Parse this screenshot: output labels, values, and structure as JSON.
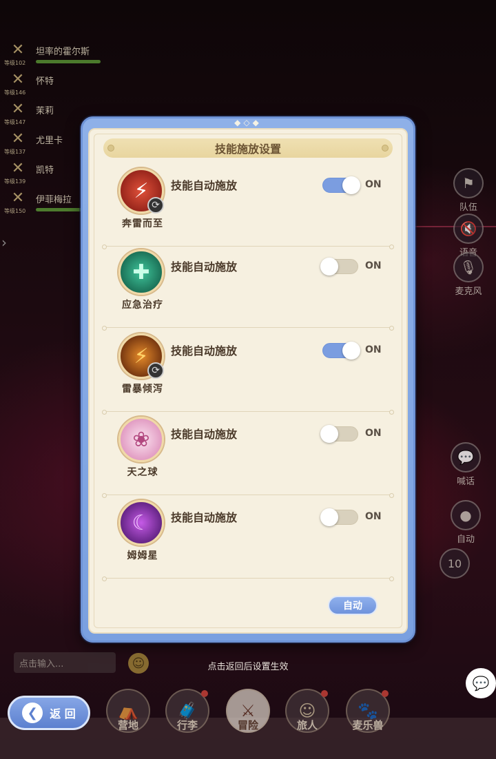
{
  "party": [
    {
      "name": "坦率的霍尔斯",
      "level": "等级102"
    },
    {
      "name": "怀特",
      "level": "等级146"
    },
    {
      "name": "茉莉",
      "level": "等级147"
    },
    {
      "name": "尤里卡",
      "level": "等级137"
    },
    {
      "name": "凯特",
      "level": "等级139"
    },
    {
      "name": "伊菲梅拉",
      "level": "等级150"
    }
  ],
  "side_buttons": {
    "team": "队伍",
    "voice": "语音",
    "mic": "麦克风",
    "shout": "喊话",
    "auto": "自动",
    "counter": "10"
  },
  "modal": {
    "title": "技能施放设置",
    "skills": [
      {
        "name": "奔雷而至",
        "label": "技能自动施放",
        "state": "ON",
        "enabled": true,
        "has_badge": true,
        "art": "⚡",
        "color": "#b3281c"
      },
      {
        "name": "应急治疗",
        "label": "技能自动施放",
        "state": "ON",
        "enabled": false,
        "has_badge": false,
        "art": "✚",
        "color": "#1c8a6a"
      },
      {
        "name": "雷暴倾泻",
        "label": "技能自动施放",
        "state": "ON",
        "enabled": true,
        "has_badge": true,
        "art": "⚡",
        "color": "#8a3a14"
      },
      {
        "name": "天之球",
        "label": "技能自动施放",
        "state": "ON",
        "enabled": false,
        "has_badge": false,
        "art": "❀",
        "color": "#e9a9c9"
      },
      {
        "name": "姆姆星",
        "label": "技能自动施放",
        "state": "ON",
        "enabled": false,
        "has_badge": false,
        "art": "☾",
        "color": "#7a2fa8"
      }
    ],
    "auto_button": "自动"
  },
  "chat": {
    "placeholder": "点击输入..."
  },
  "hint": "点击返回后设置生效",
  "back_button": "返 回",
  "nav": [
    {
      "label": "营地",
      "active": false,
      "badge": false
    },
    {
      "label": "行李",
      "active": false,
      "badge": true
    },
    {
      "label": "冒险",
      "active": true,
      "badge": false
    },
    {
      "label": "旅人",
      "active": false,
      "badge": true
    },
    {
      "label": "麦乐兽",
      "active": false,
      "badge": true
    }
  ],
  "colors": {
    "accent": "#7b9de0",
    "panel": "#f6f0e0",
    "frame": "#8eb0e8"
  }
}
